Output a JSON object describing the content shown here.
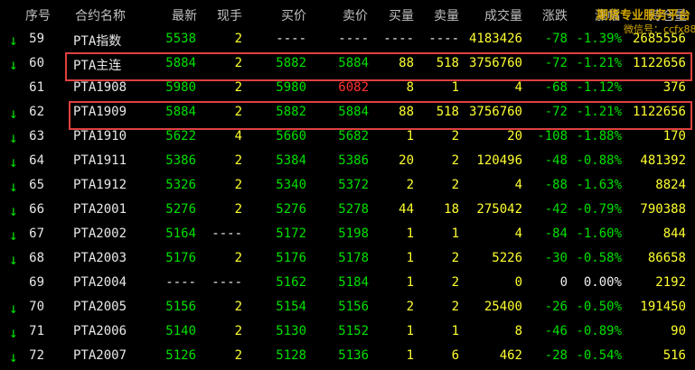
{
  "headers": [
    "序号",
    "合约名称",
    "最新",
    "现手",
    "买价",
    "卖价",
    "买量",
    "卖量",
    "成交量",
    "涨跌",
    "涨幅",
    "持仓量"
  ],
  "watermark": {
    "line1": "期货专业服务平台",
    "line2": "微信号：ccfx88"
  },
  "rows": [
    {
      "arrow": "↓",
      "seq": "59",
      "name": "PTA指数",
      "last": "5538",
      "hand": "2",
      "bid": "----",
      "ask": "----",
      "bidv": "----",
      "askv": "----",
      "vol": "4183426",
      "chg": "-78",
      "pct": "-1.39%",
      "oi": "2685556"
    },
    {
      "arrow": "↓",
      "seq": "60",
      "name": "PTA主连",
      "last": "5884",
      "hand": "2",
      "bid": "5882",
      "ask": "5884",
      "bidv": "88",
      "askv": "518",
      "vol": "3756760",
      "chg": "-72",
      "pct": "-1.21%",
      "oi": "1122656"
    },
    {
      "arrow": "",
      "seq": "61",
      "name": "PTA1908",
      "last": "5980",
      "hand": "2",
      "bid": "5980",
      "ask": "6082",
      "bidv": "8",
      "askv": "1",
      "vol": "4",
      "chg": "-68",
      "pct": "-1.12%",
      "oi": "376"
    },
    {
      "arrow": "↓",
      "seq": "62",
      "name": "PTA1909",
      "last": "5884",
      "hand": "2",
      "bid": "5882",
      "ask": "5884",
      "bidv": "88",
      "askv": "518",
      "vol": "3756760",
      "chg": "-72",
      "pct": "-1.21%",
      "oi": "1122656"
    },
    {
      "arrow": "↓",
      "seq": "63",
      "name": "PTA1910",
      "last": "5622",
      "hand": "4",
      "bid": "5660",
      "ask": "5682",
      "bidv": "1",
      "askv": "2",
      "vol": "20",
      "chg": "-108",
      "pct": "-1.88%",
      "oi": "170"
    },
    {
      "arrow": "↓",
      "seq": "64",
      "name": "PTA1911",
      "last": "5386",
      "hand": "2",
      "bid": "5384",
      "ask": "5386",
      "bidv": "20",
      "askv": "2",
      "vol": "120496",
      "chg": "-48",
      "pct": "-0.88%",
      "oi": "481392"
    },
    {
      "arrow": "↓",
      "seq": "65",
      "name": "PTA1912",
      "last": "5326",
      "hand": "2",
      "bid": "5340",
      "ask": "5372",
      "bidv": "2",
      "askv": "2",
      "vol": "4",
      "chg": "-88",
      "pct": "-1.63%",
      "oi": "8824"
    },
    {
      "arrow": "↓",
      "seq": "66",
      "name": "PTA2001",
      "last": "5276",
      "hand": "2",
      "bid": "5276",
      "ask": "5278",
      "bidv": "44",
      "askv": "18",
      "vol": "275042",
      "chg": "-42",
      "pct": "-0.79%",
      "oi": "790388"
    },
    {
      "arrow": "↓",
      "seq": "67",
      "name": "PTA2002",
      "last": "5164",
      "hand": "----",
      "bid": "5172",
      "ask": "5198",
      "bidv": "1",
      "askv": "1",
      "vol": "4",
      "chg": "-84",
      "pct": "-1.60%",
      "oi": "844"
    },
    {
      "arrow": "↓",
      "seq": "68",
      "name": "PTA2003",
      "last": "5176",
      "hand": "2",
      "bid": "5176",
      "ask": "5178",
      "bidv": "1",
      "askv": "2",
      "vol": "5226",
      "chg": "-30",
      "pct": "-0.58%",
      "oi": "86658"
    },
    {
      "arrow": "",
      "seq": "69",
      "name": "PTA2004",
      "last": "----",
      "hand": "----",
      "bid": "5162",
      "ask": "5184",
      "bidv": "1",
      "askv": "2",
      "vol": "0",
      "chg": "0",
      "pct": "0.00%",
      "oi": "2192"
    },
    {
      "arrow": "↓",
      "seq": "70",
      "name": "PTA2005",
      "last": "5156",
      "hand": "2",
      "bid": "5154",
      "ask": "5156",
      "bidv": "2",
      "askv": "2",
      "vol": "25400",
      "chg": "-26",
      "pct": "-0.50%",
      "oi": "191450"
    },
    {
      "arrow": "↓",
      "seq": "71",
      "name": "PTA2006",
      "last": "5140",
      "hand": "2",
      "bid": "5130",
      "ask": "5152",
      "bidv": "1",
      "askv": "1",
      "vol": "8",
      "chg": "-46",
      "pct": "-0.89%",
      "oi": "90"
    },
    {
      "arrow": "↓",
      "seq": "72",
      "name": "PTA2007",
      "last": "5126",
      "hand": "2",
      "bid": "5128",
      "ask": "5136",
      "bidv": "1",
      "askv": "6",
      "vol": "462",
      "chg": "-28",
      "pct": "-0.54%",
      "oi": "516"
    }
  ]
}
